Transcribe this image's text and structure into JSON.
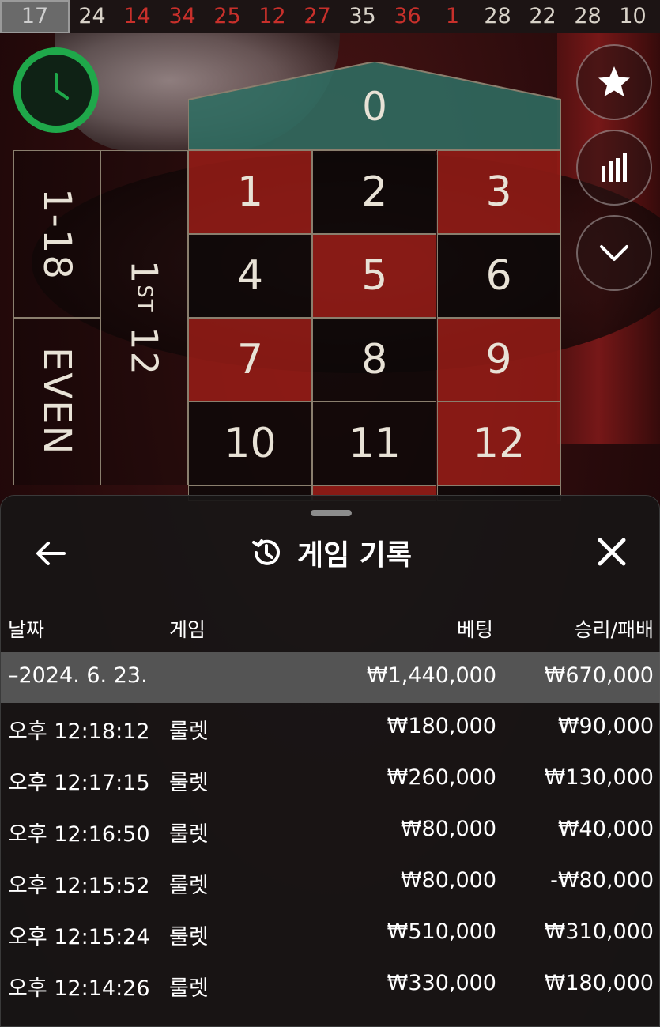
{
  "history_strip": [
    {
      "n": "17",
      "color": "gray"
    },
    {
      "n": "24",
      "color": "black"
    },
    {
      "n": "14",
      "color": "red"
    },
    {
      "n": "34",
      "color": "red"
    },
    {
      "n": "25",
      "color": "red"
    },
    {
      "n": "12",
      "color": "red"
    },
    {
      "n": "27",
      "color": "red"
    },
    {
      "n": "35",
      "color": "black"
    },
    {
      "n": "36",
      "color": "red"
    },
    {
      "n": "1",
      "color": "red"
    },
    {
      "n": "28",
      "color": "black"
    },
    {
      "n": "22",
      "color": "black"
    },
    {
      "n": "28",
      "color": "black"
    },
    {
      "n": "10",
      "color": "black"
    }
  ],
  "board": {
    "zero": "0",
    "range_label": "1-18",
    "even_label": "EVEN",
    "dozen_label_num": "1",
    "dozen_label_sup": "ST",
    "dozen_label_rest": "12",
    "numbers": [
      {
        "n": "1",
        "color": "red"
      },
      {
        "n": "2",
        "color": "black"
      },
      {
        "n": "3",
        "color": "red"
      },
      {
        "n": "4",
        "color": "black"
      },
      {
        "n": "5",
        "color": "red"
      },
      {
        "n": "6",
        "color": "black"
      },
      {
        "n": "7",
        "color": "red"
      },
      {
        "n": "8",
        "color": "black"
      },
      {
        "n": "9",
        "color": "red"
      },
      {
        "n": "10",
        "color": "black"
      },
      {
        "n": "11",
        "color": "black"
      },
      {
        "n": "12",
        "color": "red"
      }
    ]
  },
  "side_buttons": [
    "star-icon",
    "stats-icon",
    "chevron-down-icon"
  ],
  "panel": {
    "title": "게임 기록",
    "columns": {
      "date": "날짜",
      "game": "게임",
      "bet": "베팅",
      "winloss": "승리/패배"
    },
    "summary": {
      "date": "–2024. 6. 23.",
      "bet": "₩1,440,000",
      "winloss": "₩670,000"
    },
    "rows": [
      {
        "time": "오후 12:18:12",
        "game": "룰렛",
        "bet": "₩180,000",
        "winloss": "₩90,000"
      },
      {
        "time": "오후 12:17:15",
        "game": "룰렛",
        "bet": "₩260,000",
        "winloss": "₩130,000"
      },
      {
        "time": "오후 12:16:50",
        "game": "룰렛",
        "bet": "₩80,000",
        "winloss": "₩40,000"
      },
      {
        "time": "오후 12:15:52",
        "game": "룰렛",
        "bet": "₩80,000",
        "winloss": "-₩80,000"
      },
      {
        "time": "오후 12:15:24",
        "game": "룰렛",
        "bet": "₩510,000",
        "winloss": "₩310,000"
      },
      {
        "time": "오후 12:14:26",
        "game": "룰렛",
        "bet": "₩330,000",
        "winloss": "₩180,000"
      }
    ]
  },
  "colors": {
    "red": "#c8302b",
    "green": "#1fa84a",
    "zero_green": "#2f6d62"
  }
}
